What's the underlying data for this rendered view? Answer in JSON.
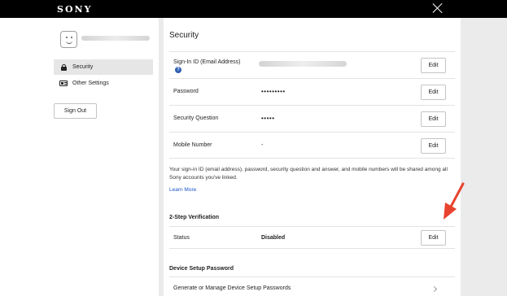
{
  "header": {
    "logo": "SONY",
    "close_icon": "close-icon"
  },
  "sidebar": {
    "avatar_icon": "avatar-face-icon",
    "items": [
      {
        "label": "Security",
        "icon": "lock-icon",
        "active": true
      },
      {
        "label": "Other Settings",
        "icon": "id-card-icon",
        "active": false
      }
    ],
    "sign_out_label": "Sign Out"
  },
  "main": {
    "title": "Security",
    "rows": [
      {
        "label": "Sign-In ID (Email Address)",
        "value": "",
        "edit": "Edit"
      },
      {
        "label": "Password",
        "value": "•••••••••",
        "edit": "Edit"
      },
      {
        "label": "Security Question",
        "value": "•••••",
        "edit": "Edit"
      },
      {
        "label": "Mobile Number",
        "value": "-",
        "edit": "Edit"
      }
    ],
    "note": "Your sign-in ID (email address), password, security question and answer, and mobile numbers will be shared among all Sony accounts you've linked.",
    "learn_more": "Learn More",
    "two_step": {
      "heading": "2-Step Verification",
      "status_label": "Status",
      "status_value": "Disabled",
      "edit": "Edit"
    },
    "device_setup": {
      "heading": "Device Setup Password",
      "link": "Generate or Manage Device Setup Passwords"
    }
  },
  "colors": {
    "annotation_arrow": "#e8432e",
    "link": "#1a54c8",
    "topbar": "#000000"
  }
}
